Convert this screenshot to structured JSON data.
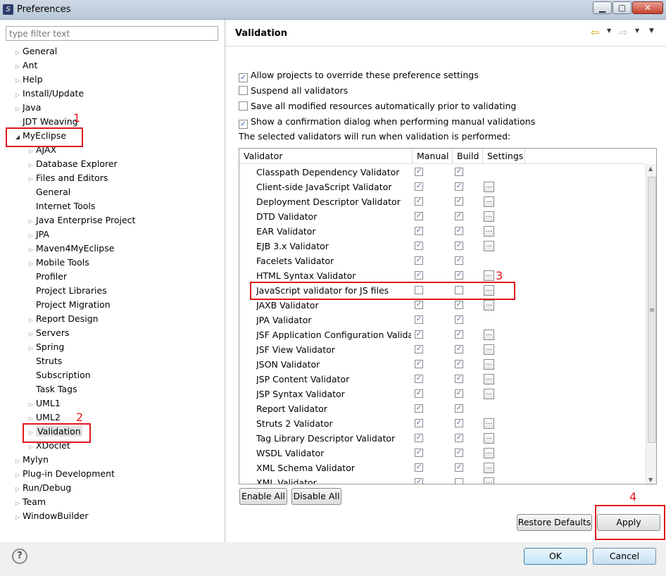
{
  "window": {
    "title": "Preferences",
    "app_icon_glyph": "S",
    "min_glyph": "▁",
    "max_glyph": "▢",
    "close_glyph": "✕"
  },
  "filter": {
    "placeholder": "type filter text"
  },
  "tree": {
    "top_before": [
      "General",
      "Ant",
      "Help",
      "Install/Update",
      "Java",
      "JDT Weaving"
    ],
    "myeclipse": "MyEclipse",
    "myeclipse_children": [
      "AJAX",
      "Database Explorer",
      "Files and Editors",
      "General",
      "Internet Tools",
      "Java Enterprise Project",
      "JPA",
      "Maven4MyEclipse",
      "Mobile Tools",
      "Profiler",
      "Project Libraries",
      "Project Migration",
      "Report Design",
      "Servers",
      "Spring",
      "Struts",
      "Subscription",
      "Task Tags",
      "UML1",
      "UML2",
      "Validation",
      "XDoclet"
    ],
    "myeclipse_children_expandable": [
      true,
      true,
      true,
      false,
      false,
      true,
      true,
      true,
      true,
      false,
      false,
      false,
      true,
      true,
      true,
      false,
      false,
      false,
      true,
      true,
      true,
      true
    ],
    "top_after": [
      "Mylyn",
      "Plug-in Development",
      "Run/Debug",
      "Team",
      "WindowBuilder"
    ],
    "expand_glyph": "▷",
    "open_glyph": "◢"
  },
  "annotations": [
    "1",
    "2",
    "3",
    "4"
  ],
  "page": {
    "title": "Validation",
    "back_glyph": "⇦",
    "fwd_glyph": "⇨",
    "dd_glyph": "▼"
  },
  "options": [
    {
      "label": "Allow projects to override these preference settings",
      "checked": true
    },
    {
      "label": "Suspend all validators",
      "checked": false
    },
    {
      "label": "Save all modified resources automatically prior to validating",
      "checked": false
    },
    {
      "label": "Show a confirmation dialog when performing manual validations",
      "checked": true
    }
  ],
  "info_text": "The selected validators will run when validation is performed:",
  "table": {
    "headers": [
      "Validator",
      "Manual",
      "Build",
      "Settings"
    ],
    "check_glyph": "✓",
    "settings_glyph": "…",
    "rows": [
      {
        "name": "Classpath Dependency Validator",
        "manual": true,
        "build": true,
        "settings": false
      },
      {
        "name": "Client-side JavaScript Validator",
        "manual": true,
        "build": true,
        "settings": true
      },
      {
        "name": "Deployment Descriptor Validator",
        "manual": true,
        "build": true,
        "settings": true
      },
      {
        "name": "DTD Validator",
        "manual": true,
        "build": true,
        "settings": true
      },
      {
        "name": "EAR Validator",
        "manual": true,
        "build": true,
        "settings": true
      },
      {
        "name": "EJB 3.x Validator",
        "manual": true,
        "build": true,
        "settings": true
      },
      {
        "name": "Facelets Validator",
        "manual": true,
        "build": true,
        "settings": false
      },
      {
        "name": "HTML Syntax Validator",
        "manual": true,
        "build": true,
        "settings": true
      },
      {
        "name": "JavaScript validator for JS files",
        "manual": false,
        "build": false,
        "settings": true
      },
      {
        "name": "JAXB Validator",
        "manual": true,
        "build": true,
        "settings": true
      },
      {
        "name": "JPA Validator",
        "manual": true,
        "build": true,
        "settings": false
      },
      {
        "name": "JSF Application Configuration Valida...",
        "manual": true,
        "build": true,
        "settings": true
      },
      {
        "name": "JSF View Validator",
        "manual": true,
        "build": true,
        "settings": true
      },
      {
        "name": "JSON Validator",
        "manual": true,
        "build": true,
        "settings": true
      },
      {
        "name": "JSP Content Validator",
        "manual": true,
        "build": true,
        "settings": true
      },
      {
        "name": "JSP Syntax Validator",
        "manual": true,
        "build": true,
        "settings": true
      },
      {
        "name": "Report Validator",
        "manual": true,
        "build": true,
        "settings": false
      },
      {
        "name": "Struts 2 Validator",
        "manual": true,
        "build": true,
        "settings": true
      },
      {
        "name": "Tag Library Descriptor Validator",
        "manual": true,
        "build": true,
        "settings": true
      },
      {
        "name": "WSDL Validator",
        "manual": true,
        "build": true,
        "settings": true
      },
      {
        "name": "XML Schema Validator",
        "manual": true,
        "build": true,
        "settings": true
      },
      {
        "name": "XML Validator",
        "manual": true,
        "build": false,
        "settings": true
      }
    ]
  },
  "scroll": {
    "up_glyph": "▲",
    "down_glyph": "▼",
    "grip_glyph": "≡"
  },
  "buttons": {
    "enable_all": "Enable All",
    "disable_all": "Disable All",
    "restore_defaults": "Restore Defaults",
    "apply": "Apply",
    "ok": "OK",
    "cancel": "Cancel"
  },
  "help_glyph": "?"
}
